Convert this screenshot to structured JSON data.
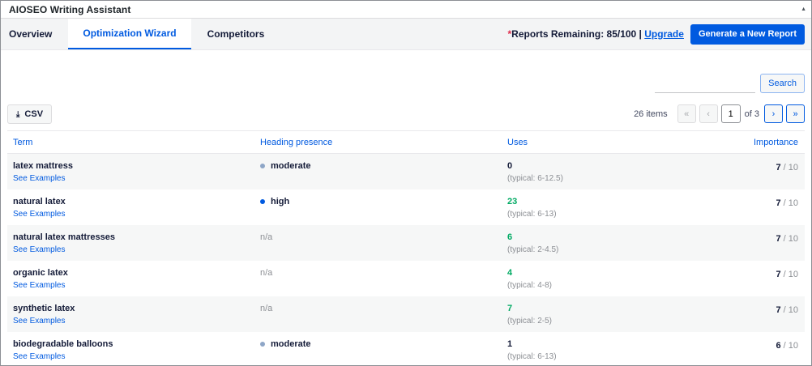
{
  "window": {
    "title": "AIOSEO Writing Assistant"
  },
  "tabs": [
    {
      "label": "Overview",
      "active": false
    },
    {
      "label": "Optimization Wizard",
      "active": true
    },
    {
      "label": "Competitors",
      "active": false
    }
  ],
  "header": {
    "reports_star": "*",
    "reports_text": "Reports Remaining: 85/100 |",
    "upgrade_label": "Upgrade",
    "generate_label": "Generate a New Report"
  },
  "search": {
    "value": "",
    "placeholder": "",
    "button_label": "Search"
  },
  "toolbar": {
    "csv_icon": "download-icon",
    "csv_label": "CSV"
  },
  "pagination": {
    "count": "26 items",
    "first": "«",
    "prev": "‹",
    "current": "1",
    "of": "of 3",
    "next": "›",
    "last": "»"
  },
  "table": {
    "columns": [
      "Term",
      "Heading presence",
      "Uses",
      "Importance"
    ],
    "rows": [
      {
        "term": "latex mattress",
        "examples": "See Examples",
        "heading": "moderate",
        "heading_color": "#8ea6c7",
        "uses": "0",
        "uses_color": "#141b38",
        "typical": "(typical: 6-12.5)",
        "importance": "7",
        "importance_max": " / 10"
      },
      {
        "term": "natural latex",
        "examples": "See Examples",
        "heading": "high",
        "heading_color": "#005ae0",
        "uses": "23",
        "uses_color": "#00aa63",
        "typical": "(typical: 6-13)",
        "importance": "7",
        "importance_max": " / 10"
      },
      {
        "term": "natural latex mattresses",
        "examples": "See Examples",
        "heading": "n/a",
        "heading_color": "",
        "uses": "6",
        "uses_color": "#00aa63",
        "typical": "(typical: 2-4.5)",
        "importance": "7",
        "importance_max": " / 10"
      },
      {
        "term": "organic latex",
        "examples": "See Examples",
        "heading": "n/a",
        "heading_color": "",
        "uses": "4",
        "uses_color": "#00aa63",
        "typical": "(typical: 4-8)",
        "importance": "7",
        "importance_max": " / 10"
      },
      {
        "term": "synthetic latex",
        "examples": "See Examples",
        "heading": "n/a",
        "heading_color": "",
        "uses": "7",
        "uses_color": "#00aa63",
        "typical": "(typical: 2-5)",
        "importance": "7",
        "importance_max": " / 10"
      },
      {
        "term": "biodegradable balloons",
        "examples": "See Examples",
        "heading": "moderate",
        "heading_color": "#8ea6c7",
        "uses": "1",
        "uses_color": "#141b38",
        "typical": "(typical: 6-13)",
        "importance": "6",
        "importance_max": " / 10"
      }
    ]
  }
}
